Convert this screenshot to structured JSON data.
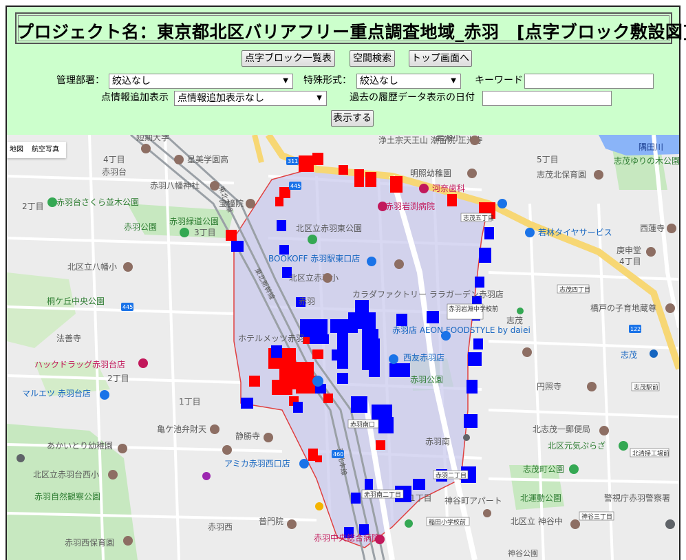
{
  "header": {
    "title": "プロジェクト名：東京都北区バリアフリー重点調査地域_赤羽　[点字ブロック敷設図]"
  },
  "toolbar": {
    "list_button": "点字ブロック一覧表",
    "spatial_button": "空間検索",
    "top_button": "トップ画面へ"
  },
  "filters": {
    "dept_label": "管理部署：",
    "dept_value": "絞込なし",
    "type_label": "特殊形式：",
    "type_value": "絞込なし",
    "keyword_label": "キーワード",
    "keyword_value": "",
    "point_label": "点情報追加表示",
    "point_value": "点情報追加表示なし",
    "history_label": "過去の履歴データ表示の日付",
    "history_value": "",
    "show_button": "表示する"
  },
  "map": {
    "type_map": "地図",
    "type_aerial": "航空写真",
    "colors": {
      "block_red": "#ff0000",
      "block_blue": "#0000ff",
      "area_fill": "#c8c8ec",
      "area_border": "#e04040",
      "park": "#c7e8c0",
      "road_major": "#f7d774",
      "water": "#8ab4f8"
    },
    "labels": {
      "l1": "短期大学",
      "l2": "星美学園高",
      "l3": "赤羽八幡神社",
      "l4": "赤羽台",
      "l5": "4丁目",
      "l6": "2丁目",
      "l7": "赤羽台さくら並木公園",
      "l8": "宝幢院",
      "l9": "赤羽公園",
      "l10": "赤羽緑道公園",
      "l11": "3丁目",
      "l12": "北区立八幡小",
      "l13": "桐ケ丘中央公園",
      "l14": "法善寺",
      "l15": "ハックドラッグ赤羽台店",
      "l16": "マルエツ 赤羽台店",
      "l17": "亀ケ池弁財天",
      "l18": "あかいとり幼稚園",
      "l19": "北区立赤羽台西小",
      "l20": "赤羽自然観察公園",
      "l21": "赤羽西",
      "l22": "赤羽西保育園",
      "l23": "静勝寺",
      "l24": "アミカ赤羽西口店",
      "l25": "普門院",
      "l26": "赤羽中央総合病院",
      "l27": "浄土宗天王山 潮留院 正光寺",
      "l28": "岩淵小",
      "l29": "明照幼稚園",
      "l30": "河奈歯科",
      "l31": "赤羽岩渕病院",
      "l32": "北区立赤羽東公園",
      "l33": "BOOKOFF 赤羽駅東口店",
      "l34": "北区立赤羽小",
      "l35": "カラダファクトリー ララガーデン赤羽店",
      "l36": "赤羽店 AEON FOODSTYLE by daiei",
      "l37": "西友赤羽店",
      "l38": "赤羽公園",
      "l39": "赤羽南",
      "l40": "神谷町アパート",
      "l41": "北区立 神谷中",
      "l42": "志茂",
      "l43": "志茂北保育園",
      "l44": "志茂ゆりの木公園",
      "l45": "5丁目",
      "l46": "隅田川",
      "l47": "若林タイヤサービス",
      "l48": "西蓮寺",
      "l49": "庚申堂",
      "l50": "4丁目",
      "l51": "橋戸の子育地蔵尊",
      "l52": "円照寺",
      "l53": "北志茂一郵便局",
      "l54": "北区元気ぷらざ",
      "l55": "志茂町公園",
      "l56": "北運動公園",
      "l57": "警視庁赤羽警察署",
      "l58": "志茂",
      "l59": "ホテルメッツ赤羽",
      "l60": "赤羽",
      "l61": "1丁目",
      "l62": "2丁目",
      "l63": "1丁目",
      "l64": "東北本線",
      "l65": "東北本線",
      "l66": "東北新幹線",
      "l67": "志茂四丁目",
      "l68": "志茂駅前",
      "l69": "北清掃工場前",
      "l70": "神谷三丁目",
      "l71": "稲田小学校前",
      "l72": "赤羽岩淵中学校前",
      "l73": "赤羽南二丁目",
      "l74": "赤羽二丁目",
      "l75": "赤羽南口",
      "l76": "志茂五丁目",
      "l77": "神谷公園"
    }
  }
}
